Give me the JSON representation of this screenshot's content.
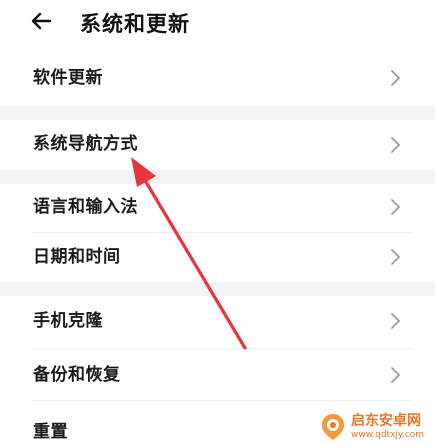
{
  "header": {
    "back_icon": "back-arrow-icon",
    "title": "系统和更新"
  },
  "items": [
    {
      "label": "软件更新",
      "icon": "chevron-right-icon"
    },
    {
      "label": "系统导航方式",
      "icon": "chevron-right-icon"
    },
    {
      "label": "语言和输入法",
      "icon": "chevron-right-icon"
    },
    {
      "label": "日期和时间",
      "icon": "chevron-right-icon"
    },
    {
      "label": "手机克隆",
      "icon": "chevron-right-icon"
    },
    {
      "label": "备份和恢复",
      "icon": "chevron-right-icon"
    },
    {
      "label": "重置",
      "icon": "chevron-right-icon"
    }
  ],
  "annotation": {
    "color": "#e8343a",
    "icon": "red-pointer-arrow"
  },
  "watermark": {
    "name": "启东安卓网",
    "url": "www.qdtxjy.com",
    "color": "#e8762b"
  },
  "colors": {
    "background": "#ffffff",
    "section_gap": "#f3f3f3",
    "chevron": "#9a9a9a"
  }
}
